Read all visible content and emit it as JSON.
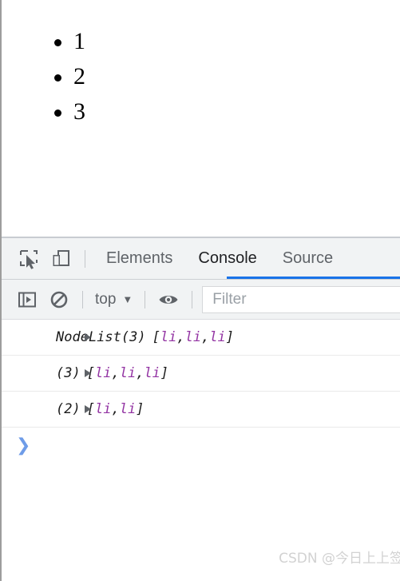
{
  "page": {
    "list_items": [
      "1",
      "2",
      "3"
    ]
  },
  "devtools": {
    "tabbar": {
      "inspect_icon": "inspect-element-icon",
      "device_icon": "device-toolbar-icon",
      "tabs": [
        {
          "label": "Elements",
          "active": false
        },
        {
          "label": "Console",
          "active": true
        },
        {
          "label": "Source",
          "active": false
        }
      ],
      "active_tab": "Console",
      "active_underline_color": "#1a73e8"
    },
    "toolbar": {
      "sidebar_toggle_icon": "console-sidebar-icon",
      "clear_console_icon": "clear-console-icon",
      "context_label": "top",
      "context_caret": "▼",
      "eye_icon": "live-expression-eye-icon",
      "filter_placeholder": "Filter"
    },
    "console": {
      "messages": [
        {
          "expander": "▶",
          "constructor": "NodeList(3)",
          "open_bracket": "[",
          "tokens": [
            "li",
            "li",
            "li"
          ],
          "separator": ", ",
          "close_bracket": "]"
        },
        {
          "expander": "▶",
          "constructor": "(3)",
          "open_bracket": "[",
          "tokens": [
            "li",
            "li",
            "li"
          ],
          "separator": ", ",
          "close_bracket": "]"
        },
        {
          "expander": "▶",
          "constructor": "(2)",
          "open_bracket": "[",
          "tokens": [
            "li",
            "li"
          ],
          "separator": ", ",
          "close_bracket": "]"
        }
      ],
      "prompt_chevron": "❯",
      "prompt_input_value": "",
      "node_token_color": "#9334a3"
    }
  },
  "watermark": {
    "text": "CSDN @今日上上签"
  }
}
